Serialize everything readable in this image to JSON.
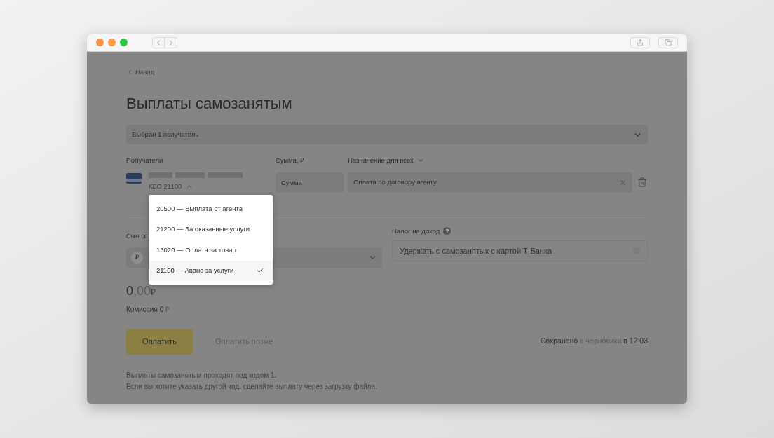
{
  "back_link": "Назад",
  "title": "Выплаты самозанятым",
  "recipients_select": "Выбран 1 получатель",
  "columns": {
    "recipients": "Получатели",
    "amount": "Сумма, ₽",
    "purpose": "Назначение для всех"
  },
  "recipient": {
    "kvo": "КВО 21100",
    "expanded": true,
    "amount_placeholder": "Сумма",
    "purpose": "Оплата по договору агенту"
  },
  "kvo_options": [
    {
      "label": "20500 — Выплата от агента",
      "selected": false
    },
    {
      "label": "21200 — За оказанные услуги",
      "selected": false
    },
    {
      "label": "13020 — Оплата за товар",
      "selected": false
    },
    {
      "label": "21100 — Аванс за услуги",
      "selected": true
    }
  ],
  "account": {
    "label": "Счет сп",
    "currency": "₽"
  },
  "tax": {
    "label": "Налог на доход",
    "help": "?",
    "option": "Удержать с самозанятых с картой Т-Банка",
    "checked": false
  },
  "total": {
    "integer": "0",
    "fraction": ",00",
    "currency": "₽"
  },
  "commission": {
    "text": "Комиссия 0",
    "currency": "₽"
  },
  "buttons": {
    "pay": "Оплатить",
    "pay_later": "Оплатить позже"
  },
  "saved": {
    "before": "Сохранено",
    "link": "в черновики",
    "after": "в 12:03"
  },
  "notes": [
    "Выплаты самозанятым проходят под кодом 1.",
    "Если вы хотите указать другой код, сделайте выплату через загрузку файла."
  ]
}
